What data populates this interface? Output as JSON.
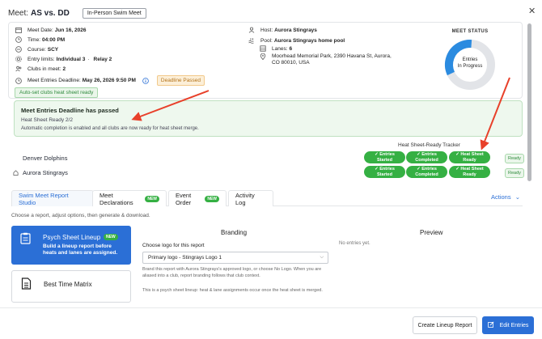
{
  "header": {
    "label": "Meet:",
    "title": "AS vs. DD",
    "chip": "In-Person Swim Meet",
    "close": "✕"
  },
  "info": {
    "meet_date_label": "Meet Date:",
    "meet_date": "Jun 16, 2026",
    "time_label": "Time:",
    "time": "04:00 PM",
    "course_label": "Course:",
    "course": "SCY",
    "entry_limits_label": "Entry limits:",
    "entry_limits_individual": "Individual 3",
    "entry_limits_sep": "·",
    "entry_limits_relay": "Relay 2",
    "clubs_label": "Clubs in meet:",
    "clubs": "2",
    "deadline_label": "Meet Entries Deadline:",
    "deadline": "May 26, 2026 9:50 PM",
    "deadline_badge": "Deadline Passed",
    "host_label": "Host:",
    "host": "Aurora Stingrays",
    "pool_label": "Pool:",
    "pool": "Aurora Stingrays home pool",
    "lanes_label": "Lanes:",
    "lanes": "6",
    "address_line1": "Moorhead Memorial Park, 2390 Havana St, Aurora,",
    "address_line2": "CO 80010, USA",
    "autoset": "Auto-set clubs heat sheet ready"
  },
  "status": {
    "title": "MEET STATUS",
    "label_line1": "Entries",
    "label_line2": "In Progress",
    "progress_fraction": 0.33,
    "accent": "#2b8be0",
    "track": "#e2e4e8"
  },
  "alert": {
    "title": "Meet Entries Deadline has passed",
    "subtitle": "Heat Sheet Ready 2/2",
    "body": "Automatic completion is enabled and all clubs are now ready for heat sheet merge."
  },
  "tracker": {
    "title": "Heat Sheet-Ready Tracker",
    "clubs": [
      {
        "name": "Denver Dolphins",
        "pills": [
          [
            "✓ Entries",
            "Started"
          ],
          [
            "✓ Entries",
            "Completed"
          ],
          [
            "✓ Heat Sheet",
            "Ready"
          ]
        ],
        "status": "Ready"
      },
      {
        "name": "Aurora Stingrays",
        "pills": [
          [
            "✓ Entries",
            "Started"
          ],
          [
            "✓ Entries",
            "Completed"
          ],
          [
            "✓ Heat Sheet",
            "Ready"
          ]
        ],
        "status": "Ready"
      }
    ]
  },
  "tabs": {
    "items": [
      "Swim Meet Report Studio",
      "Meet Declarations",
      "Event Order",
      "Activity Log"
    ],
    "new_badge": "NEW",
    "actions": "Actions"
  },
  "studio": {
    "choose": "Choose a report, adjust options, then generate & download.",
    "psych_title": "Psych Sheet Lineup",
    "psych_desc": "Build a lineup report before heats and lanes are assigned.",
    "best_title": "Best Time Matrix",
    "branding": "Branding",
    "preview": "Preview",
    "logo_label": "Choose logo for this report",
    "logo_value": "Primary logo - Stingrays Logo 1",
    "no_entries": "No entries yet.",
    "help1": "Brand this report with Aurora Stingrays's approved logo, or choose No Logo. When you are aliased into a club, report branding follows that club context.",
    "help2": "This is a psych sheet lineup: heat & lane assignments occur once the heat sheet is merged."
  },
  "footer": {
    "create": "Create Lineup Report",
    "edit": "Edit Entries"
  },
  "colors": {
    "primary": "#2b6fd6",
    "success": "#35b043",
    "annotation": "#e8402a"
  }
}
